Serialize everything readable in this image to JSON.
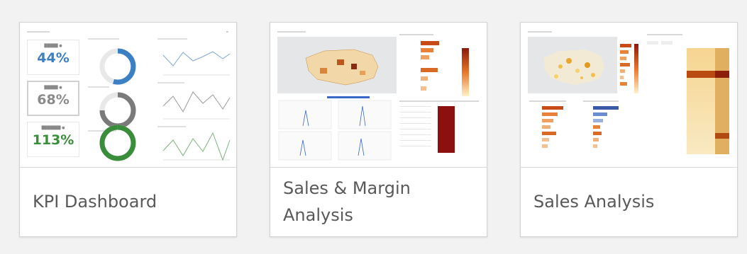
{
  "cards": [
    {
      "title": "KPI Dashboard",
      "kpis": [
        {
          "value": "44%",
          "color": "#3b7fc4"
        },
        {
          "value": "68%",
          "color": "#8a8a8a"
        },
        {
          "value": "113%",
          "color": "#3a8d3a"
        }
      ]
    },
    {
      "title": "Sales & Margin Analysis"
    },
    {
      "title": "Sales Analysis"
    }
  ]
}
